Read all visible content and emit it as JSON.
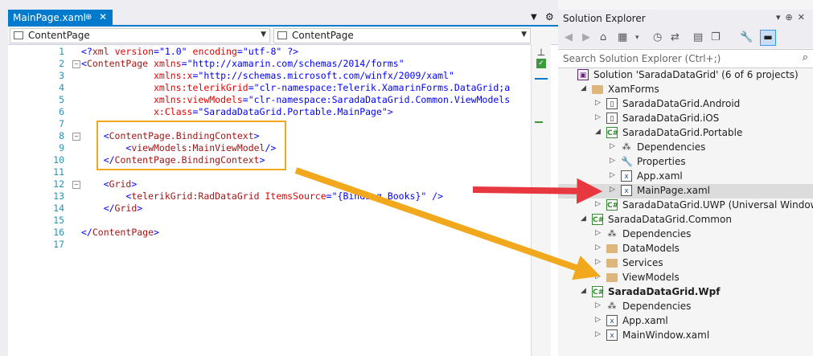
{
  "editor": {
    "tab": {
      "title": "MainPage.xaml",
      "pin_icon": "pin-icon",
      "close_icon": "close-icon"
    },
    "nav_left": "ContentPage",
    "nav_right": "ContentPage",
    "lines": [
      {
        "n": "1",
        "fold": "",
        "parts": [
          [
            "pi",
            "<?"
          ],
          [
            "tg",
            "xml"
          ],
          [
            "at",
            " version"
          ],
          [
            "pn",
            "="
          ],
          [
            "vl",
            "\"1.0\""
          ],
          [
            "at",
            " encoding"
          ],
          [
            "pn",
            "="
          ],
          [
            "vl",
            "\"utf-8\""
          ],
          [
            "pn",
            " "
          ],
          [
            "pi",
            "?>"
          ]
        ]
      },
      {
        "n": "2",
        "fold": "−",
        "parts": [
          [
            "pn",
            "<"
          ],
          [
            "tg",
            "ContentPage"
          ],
          [
            "at",
            " xmlns"
          ],
          [
            "pn",
            "="
          ],
          [
            "vl",
            "\"http://xamarin.com/schemas/2014/forms\""
          ]
        ]
      },
      {
        "n": "3",
        "fold": "",
        "parts": [
          [
            "at",
            "             xmlns:x"
          ],
          [
            "pn",
            "="
          ],
          [
            "vl",
            "\"http://schemas.microsoft.com/winfx/2009/xaml\""
          ]
        ]
      },
      {
        "n": "4",
        "fold": "",
        "parts": [
          [
            "at",
            "             xmlns:telerikGrid"
          ],
          [
            "pn",
            "="
          ],
          [
            "vl",
            "\"clr-namespace:Telerik.XamarinForms.DataGrid;a"
          ]
        ]
      },
      {
        "n": "5",
        "fold": "",
        "parts": [
          [
            "at",
            "             xmlns:viewModels"
          ],
          [
            "pn",
            "="
          ],
          [
            "vl",
            "\"clr-namespace:SaradaDataGrid.Common.ViewModels"
          ]
        ]
      },
      {
        "n": "6",
        "fold": "",
        "parts": [
          [
            "at",
            "             x:Class"
          ],
          [
            "pn",
            "="
          ],
          [
            "vl",
            "\"SaradaDataGrid.Portable.MainPage\""
          ],
          [
            "pn",
            ">"
          ]
        ]
      },
      {
        "n": "7",
        "fold": "",
        "parts": []
      },
      {
        "n": "8",
        "fold": "−",
        "parts": [
          [
            "pn",
            "    <"
          ],
          [
            "tg",
            "ContentPage.BindingContext"
          ],
          [
            "pn",
            ">"
          ]
        ]
      },
      {
        "n": "9",
        "fold": "",
        "parts": [
          [
            "pn",
            "        <"
          ],
          [
            "tg",
            "viewModels:MainViewModel"
          ],
          [
            "pn",
            "/>"
          ]
        ]
      },
      {
        "n": "10",
        "fold": "",
        "parts": [
          [
            "pn",
            "    </"
          ],
          [
            "tg",
            "ContentPage.BindingContext"
          ],
          [
            "pn",
            ">"
          ]
        ]
      },
      {
        "n": "11",
        "fold": "",
        "parts": []
      },
      {
        "n": "12",
        "fold": "−",
        "parts": [
          [
            "pn",
            "    <"
          ],
          [
            "tg",
            "Grid"
          ],
          [
            "pn",
            ">"
          ]
        ]
      },
      {
        "n": "13",
        "fold": "",
        "parts": [
          [
            "pn",
            "        <"
          ],
          [
            "tg",
            "telerikGrid:RadDataGrid"
          ],
          [
            "at",
            " ItemsSource"
          ],
          [
            "pn",
            "="
          ],
          [
            "vl",
            "\"{Binding Books}\""
          ],
          [
            "pn",
            " />"
          ]
        ]
      },
      {
        "n": "14",
        "fold": "",
        "parts": [
          [
            "pn",
            "    </"
          ],
          [
            "tg",
            "Grid"
          ],
          [
            "pn",
            ">"
          ]
        ]
      },
      {
        "n": "15",
        "fold": "",
        "parts": []
      },
      {
        "n": "16",
        "fold": "",
        "parts": [
          [
            "pn",
            "</"
          ],
          [
            "tg",
            "ContentPage"
          ],
          [
            "pn",
            ">"
          ]
        ]
      },
      {
        "n": "17",
        "fold": "",
        "parts": []
      }
    ]
  },
  "solution_explorer": {
    "title": "Solution Explorer",
    "search_placeholder": "Search Solution Explorer (Ctrl+;)",
    "nodes": [
      {
        "depth": 0,
        "arrow": "",
        "icon": "sln",
        "glyph": "▣",
        "label": "Solution 'SaradaDataGrid' (6 of 6 projects)",
        "bold": false
      },
      {
        "depth": 1,
        "arrow": "◢",
        "icon": "folder",
        "glyph": "",
        "label": "XamForms",
        "bold": false
      },
      {
        "depth": 2,
        "arrow": "▷",
        "icon": "proj",
        "glyph": "▯",
        "label": "SaradaDataGrid.Android",
        "bold": false
      },
      {
        "depth": 2,
        "arrow": "▷",
        "icon": "proj",
        "glyph": "▯",
        "label": "SaradaDataGrid.iOS",
        "bold": false
      },
      {
        "depth": 2,
        "arrow": "◢",
        "icon": "cs",
        "glyph": "C#",
        "label": "SaradaDataGrid.Portable",
        "bold": false
      },
      {
        "depth": 3,
        "arrow": "▷",
        "icon": "dep",
        "glyph": "⁂",
        "label": "Dependencies",
        "bold": false
      },
      {
        "depth": 3,
        "arrow": "▷",
        "icon": "wrench",
        "glyph": "🔧",
        "label": "Properties",
        "bold": false
      },
      {
        "depth": 3,
        "arrow": "▷",
        "icon": "xaml",
        "glyph": "x",
        "label": "App.xaml",
        "bold": false
      },
      {
        "depth": 3,
        "arrow": "▷",
        "icon": "xaml",
        "glyph": "x",
        "label": "MainPage.xaml",
        "bold": false,
        "selected": true
      },
      {
        "depth": 2,
        "arrow": "▷",
        "icon": "cs",
        "glyph": "C#",
        "label": "SaradaDataGrid.UWP (Universal Windows)",
        "bold": false
      },
      {
        "depth": 1,
        "arrow": "◢",
        "icon": "cs",
        "glyph": "C#",
        "label": "SaradaDataGrid.Common",
        "bold": false
      },
      {
        "depth": 2,
        "arrow": "▷",
        "icon": "dep",
        "glyph": "⁂",
        "label": "Dependencies",
        "bold": false
      },
      {
        "depth": 2,
        "arrow": "▷",
        "icon": "folder",
        "glyph": "",
        "label": "DataModels",
        "bold": false
      },
      {
        "depth": 2,
        "arrow": "▷",
        "icon": "folder",
        "glyph": "",
        "label": "Services",
        "bold": false
      },
      {
        "depth": 2,
        "arrow": "▷",
        "icon": "folder",
        "glyph": "",
        "label": "ViewModels",
        "bold": false
      },
      {
        "depth": 1,
        "arrow": "◢",
        "icon": "cs",
        "glyph": "C#",
        "label": "SaradaDataGrid.Wpf",
        "bold": true
      },
      {
        "depth": 2,
        "arrow": "▷",
        "icon": "dep",
        "glyph": "⁂",
        "label": "Dependencies",
        "bold": false
      },
      {
        "depth": 2,
        "arrow": "▷",
        "icon": "xaml",
        "glyph": "x",
        "label": "App.xaml",
        "bold": false
      },
      {
        "depth": 2,
        "arrow": "▷",
        "icon": "xaml",
        "glyph": "x",
        "label": "MainWindow.xaml",
        "bold": false
      }
    ]
  },
  "annotations": {
    "orange_color": "#f2a81d",
    "red_color": "#e8383f"
  }
}
